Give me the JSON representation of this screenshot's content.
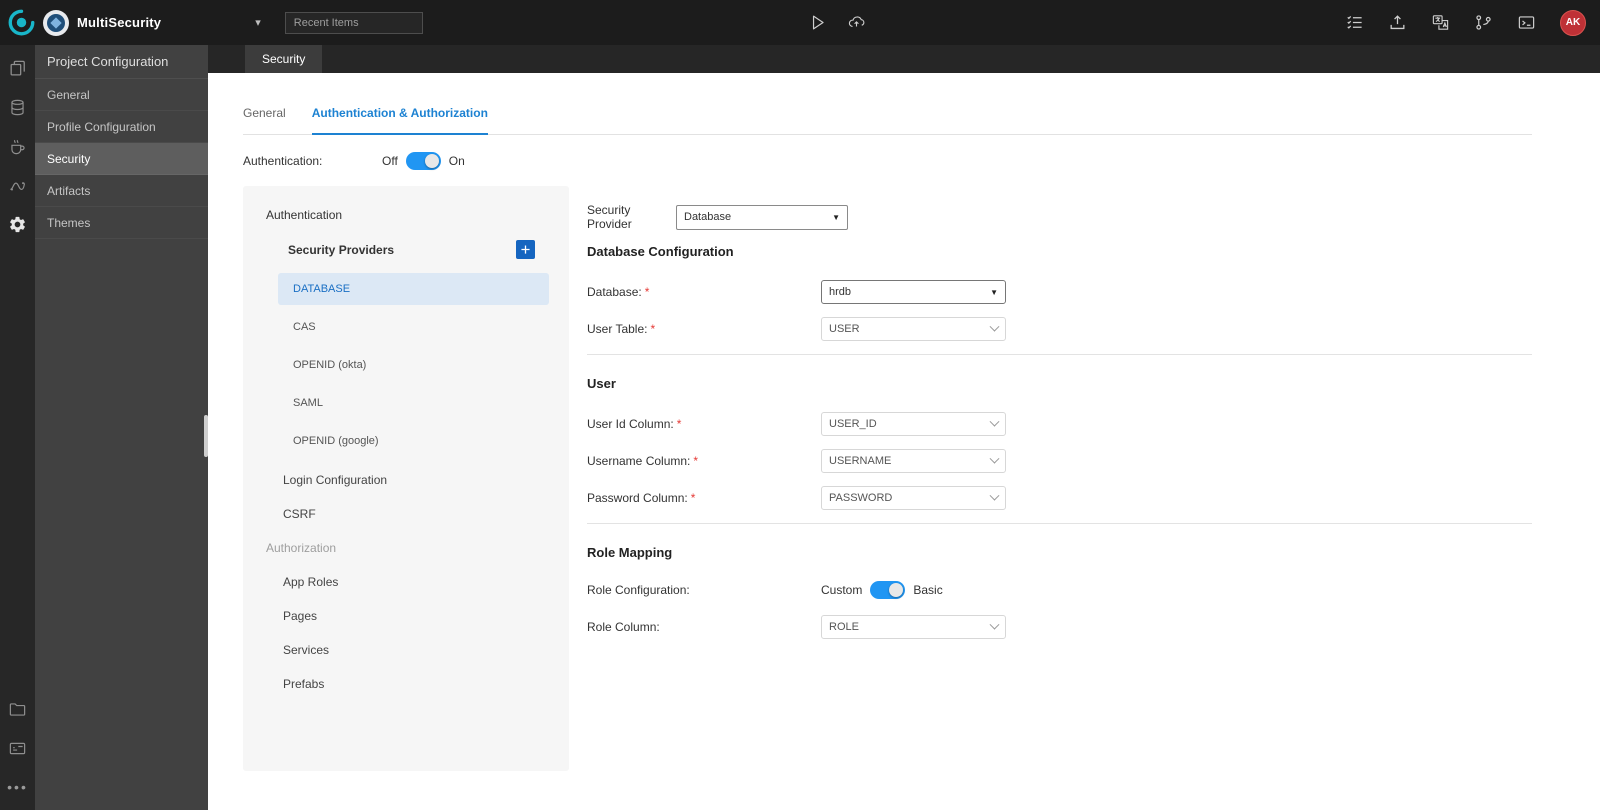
{
  "topbar": {
    "project_name": "MultiSecurity",
    "recent_items_placeholder": "Recent Items",
    "avatar_initials": "AK"
  },
  "sidebar": {
    "title": "Project Configuration",
    "items": [
      {
        "label": "General"
      },
      {
        "label": "Profile Configuration"
      },
      {
        "label": "Security"
      },
      {
        "label": "Artifacts"
      },
      {
        "label": "Themes"
      }
    ]
  },
  "doc_tab": "Security",
  "tabs": {
    "general": "General",
    "auth": "Authentication & Authorization"
  },
  "auth_toggle": {
    "label": "Authentication:",
    "off": "Off",
    "on": "On",
    "state": "On"
  },
  "nav": {
    "authentication_header": "Authentication",
    "security_providers_label": "Security Providers",
    "providers": [
      {
        "label": "DATABASE"
      },
      {
        "label": "CAS"
      },
      {
        "label": "OPENID (okta)"
      },
      {
        "label": "SAML"
      },
      {
        "label": "OPENID (google)"
      }
    ],
    "login_configuration": "Login Configuration",
    "csrf": "CSRF",
    "authorization_header": "Authorization",
    "items": [
      {
        "label": "App Roles"
      },
      {
        "label": "Pages"
      },
      {
        "label": "Services"
      },
      {
        "label": "Prefabs"
      }
    ]
  },
  "form": {
    "required_marker": "*",
    "security_provider_label": "Security Provider",
    "security_provider_value": "Database",
    "db_section_title": "Database Configuration",
    "database_label": "Database:",
    "database_value": "hrdb",
    "user_table_label": "User Table:",
    "user_table_value": "USER",
    "user_section_title": "User",
    "user_id_label": "User Id Column:",
    "user_id_value": "USER_ID",
    "username_label": "Username Column:",
    "username_value": "USERNAME",
    "password_label": "Password Column:",
    "password_value": "PASSWORD",
    "role_section_title": "Role Mapping",
    "role_config_label": "Role Configuration:",
    "role_custom": "Custom",
    "role_basic": "Basic",
    "role_state": "Basic",
    "role_column_label": "Role Column:",
    "role_column_value": "ROLE"
  },
  "colors": {
    "accent_blue": "#1d82d2",
    "toggle_blue": "#2196f3",
    "selected_nav_bg": "#dce8f5",
    "selected_nav_text": "#1a6fc4",
    "required_red": "#e53935",
    "avatar_red": "#bf3136",
    "topbar_bg": "#1c1c1c",
    "sidebar_bg": "#414141"
  }
}
